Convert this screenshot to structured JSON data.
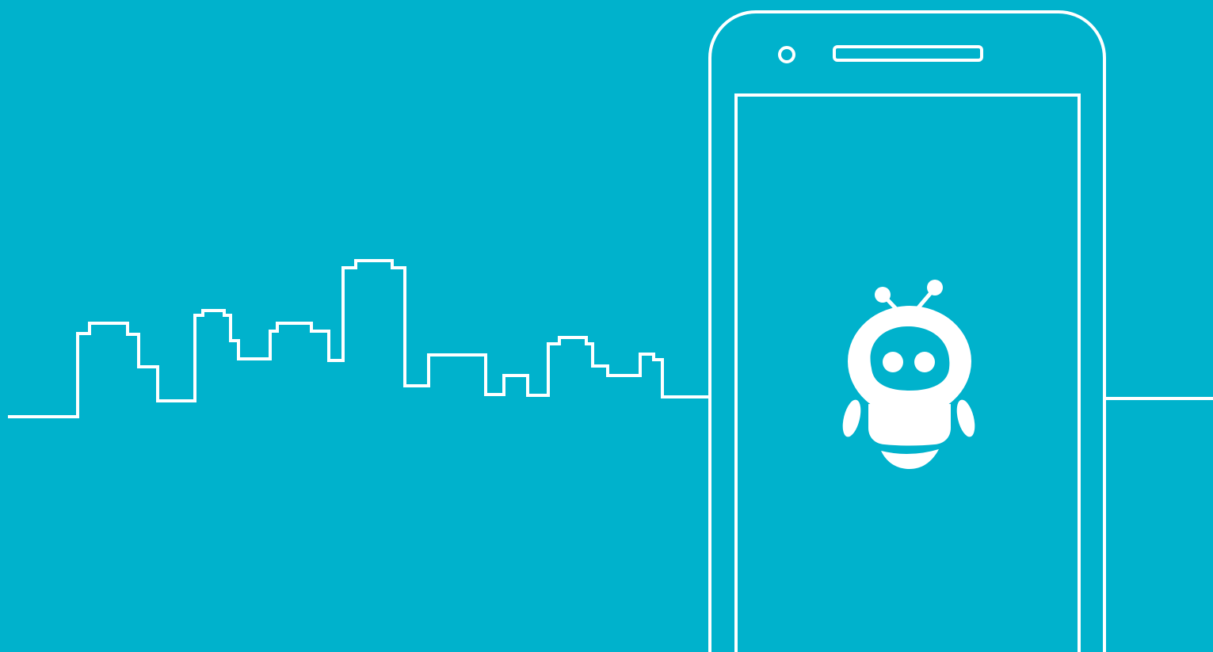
{
  "colors": {
    "background": "#00B2CC",
    "stroke": "#FFFFFF",
    "mascot": "#FFFFFF"
  },
  "icons": {
    "skyline": "city-skyline-line-art",
    "device": "smartphone-outline",
    "mascot": "robot-mascot"
  }
}
